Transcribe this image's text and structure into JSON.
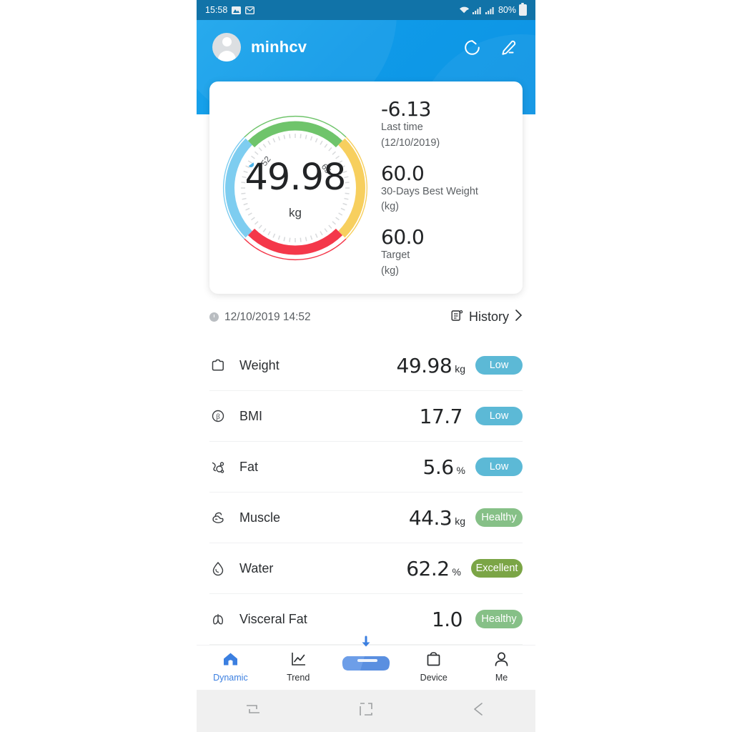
{
  "status_bar": {
    "time": "15:58",
    "battery_percent": "80%",
    "icons": [
      "photo-icon",
      "mail-icon",
      "wifi-icon",
      "signal-icon",
      "signal-icon",
      "battery-icon"
    ]
  },
  "header": {
    "username": "minhcv",
    "avatar": "avatar-icon",
    "share_icon": "refresh-share-icon",
    "edit_icon": "pencil-icon",
    "bg_color": "#0f9ae8"
  },
  "gauge": {
    "value": "49.98",
    "unit": "kg",
    "tick_label_low": "52",
    "tick_label_high": "65",
    "pointer_color": "#4bb3e8",
    "segments": [
      {
        "name": "low",
        "color": "#7ecdf0"
      },
      {
        "name": "healthy",
        "color": "#6fc46b"
      },
      {
        "name": "overweight",
        "color": "#f7cf5e"
      },
      {
        "name": "obese",
        "color": "#f4384a"
      }
    ]
  },
  "stats": [
    {
      "value": "-6.13",
      "label_line1": "Last time",
      "label_line2": "(12/10/2019)"
    },
    {
      "value": "60.0",
      "label_line1": "30-Days Best Weight",
      "label_line2": "(kg)"
    },
    {
      "value": "60.0",
      "label_line1": "Target",
      "label_line2": "(kg)"
    }
  ],
  "history_row": {
    "timestamp": "12/10/2019 14:52",
    "clock_icon": "clock-icon",
    "history_label": "History",
    "history_icon": "list-document-icon",
    "chevron": "›"
  },
  "metrics": [
    {
      "icon": "weight-scale-icon",
      "name": "Weight",
      "value": "49.98",
      "unit": "kg",
      "badge": "Low",
      "badge_color": "#5cb9d6"
    },
    {
      "icon": "bmi-icon",
      "name": "BMI",
      "value": "17.7",
      "unit": "",
      "badge": "Low",
      "badge_color": "#5cb9d6"
    },
    {
      "icon": "fat-molecule-icon",
      "name": "Fat",
      "value": "5.6",
      "unit": "%",
      "badge": "Low",
      "badge_color": "#5cb9d6"
    },
    {
      "icon": "muscle-arm-icon",
      "name": "Muscle",
      "value": "44.3",
      "unit": "kg",
      "badge": "Healthy",
      "badge_color": "#86c087"
    },
    {
      "icon": "water-drop-icon",
      "name": "Water",
      "value": "62.2",
      "unit": "%",
      "badge": "Excellent",
      "badge_color": "#7ba546"
    },
    {
      "icon": "visceral-fat-icon",
      "name": "Visceral Fat",
      "value": "1.0",
      "unit": "",
      "badge": "Healthy",
      "badge_color": "#86c087"
    }
  ],
  "tabbar": {
    "active_color": "#3b7fe0",
    "items": [
      {
        "icon": "home-icon",
        "label": "Dynamic",
        "active": true
      },
      {
        "icon": "chart-trend-icon",
        "label": "Trend",
        "active": false
      },
      {
        "icon": "scale-device-icon",
        "label": "",
        "active": false
      },
      {
        "icon": "device-bag-icon",
        "label": "Device",
        "active": false
      },
      {
        "icon": "person-icon",
        "label": "Me",
        "active": false
      }
    ]
  },
  "android_nav": {
    "recents_icon": "recents-icon",
    "home_icon": "home-square-icon",
    "back_icon": "back-arrow-icon"
  }
}
